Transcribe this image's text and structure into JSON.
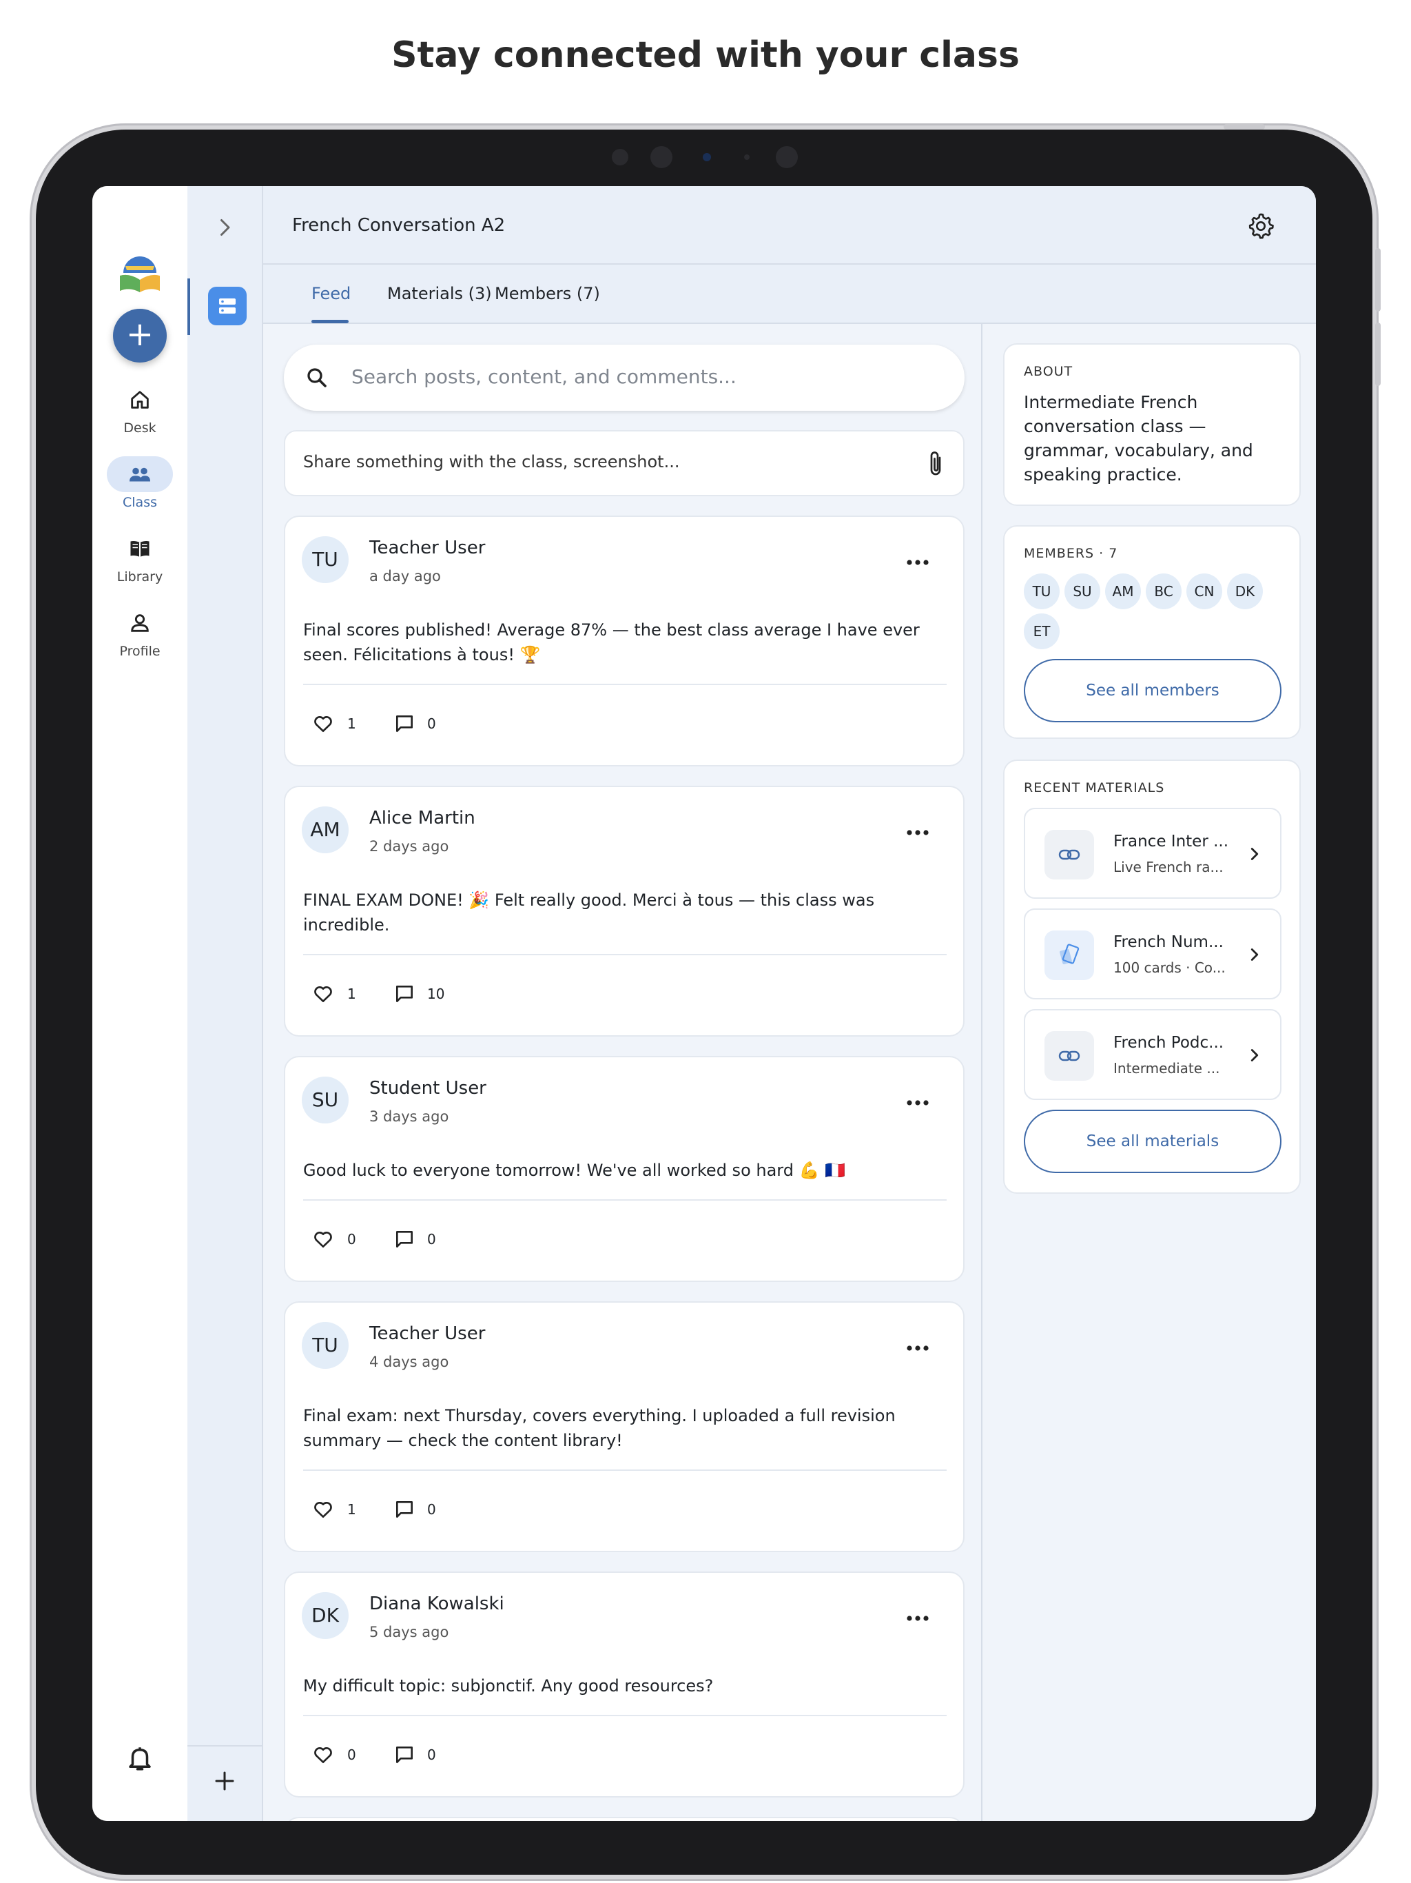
{
  "headline": "Stay connected with your class",
  "rail": {
    "items": [
      {
        "label": "Desk",
        "icon": "home-icon"
      },
      {
        "label": "Class",
        "icon": "people-icon"
      },
      {
        "label": "Library",
        "icon": "book-icon"
      },
      {
        "label": "Profile",
        "icon": "person-icon"
      }
    ]
  },
  "class": {
    "title": "French Conversation A2"
  },
  "tabs": [
    {
      "label": "Feed"
    },
    {
      "label": "Materials (3)"
    },
    {
      "label": "Members (7)"
    }
  ],
  "search": {
    "placeholder": "Search posts, content, and comments..."
  },
  "composer": {
    "placeholder": "Share something with the class, screenshot..."
  },
  "posts": [
    {
      "initials": "TU",
      "author": "Teacher User",
      "time": "a day ago",
      "text": "Final scores published! Average 87% — the best class average I have ever seen. Félicitations à tous! 🏆",
      "likes": "1",
      "comments": "0"
    },
    {
      "initials": "AM",
      "author": "Alice Martin",
      "time": "2 days ago",
      "text": "FINAL EXAM DONE! 🎉 Felt really good. Merci à tous — this class was incredible.",
      "likes": "1",
      "comments": "10"
    },
    {
      "initials": "SU",
      "author": "Student User",
      "time": "3 days ago",
      "text": "Good luck to everyone tomorrow! We've all worked so hard 💪 🇫🇷",
      "likes": "0",
      "comments": "0"
    },
    {
      "initials": "TU",
      "author": "Teacher User",
      "time": "4 days ago",
      "text": "Final exam: next Thursday, covers everything. I uploaded a full revision summary — check the content library!",
      "likes": "1",
      "comments": "0"
    },
    {
      "initials": "DK",
      "author": "Diana Kowalski",
      "time": "5 days ago",
      "text": "My difficult topic: subjonctif. Any good resources?",
      "likes": "0",
      "comments": "0"
    }
  ],
  "about": {
    "caption": "ABOUT",
    "text": "Intermediate French conversation class — grammar, vocabulary, and speaking practice."
  },
  "members": {
    "caption": "MEMBERS · 7",
    "initials": [
      "TU",
      "SU",
      "AM",
      "BC",
      "CN",
      "DK",
      "ET"
    ],
    "see_all": "See all members"
  },
  "materials": {
    "caption": "RECENT MATERIALS",
    "items": [
      {
        "title": "France Inter ...",
        "subtitle": "Live French ra...",
        "icon": "link-icon"
      },
      {
        "title": "French Num...",
        "subtitle": "100 cards · Co...",
        "icon": "flashcards-icon"
      },
      {
        "title": "French Podc...",
        "subtitle": "Intermediate ...",
        "icon": "link-icon"
      }
    ],
    "see_all": "See all materials"
  },
  "colors": {
    "accent": "#3f6aa8",
    "panel_accent": "#4a8ee8",
    "background": "#f0f4fa"
  }
}
